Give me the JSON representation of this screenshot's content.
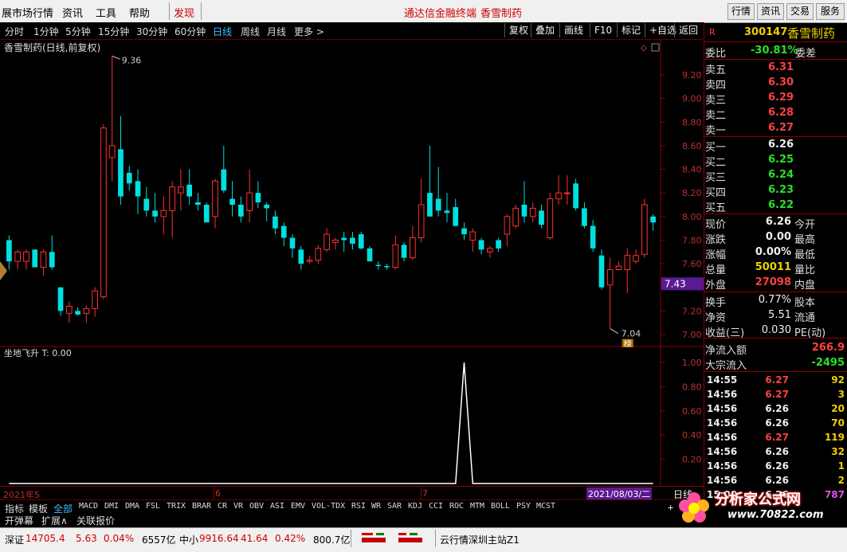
{
  "menu": {
    "items": [
      "展市场行情",
      "资讯",
      "工具",
      "帮助"
    ],
    "discover": "发现",
    "center_title": "通达信金融终端",
    "center_stock": "香雪制药",
    "right_buttons": [
      "行情",
      "资讯",
      "交易",
      "服务"
    ]
  },
  "toolbar": {
    "periods": [
      "分时",
      "1分钟",
      "5分钟",
      "15分钟",
      "30分钟",
      "60分钟",
      "日线",
      "周线",
      "月线",
      "更多 >"
    ],
    "active_period": "日线",
    "actions": [
      "复权",
      "叠加",
      "画线",
      "F10",
      "标记",
      "+自选",
      "返回"
    ]
  },
  "kline": {
    "title": "香雪制药(日线,前复权)",
    "high_label": "9.36",
    "low_label": "7.04",
    "badge": "榜",
    "current_price_tag": "7.43",
    "y_ticks": [
      "9.20",
      "9.00",
      "8.80",
      "8.60",
      "8.40",
      "8.20",
      "8.00",
      "7.80",
      "7.60",
      "7.40",
      "7.20",
      "7.00"
    ]
  },
  "indicator": {
    "title": "坐地飞升  T: 0.00",
    "y_ticks": [
      "1.00",
      "0.80",
      "0.60",
      "0.40",
      "0.20"
    ]
  },
  "date_axis": {
    "labels": [
      "2021年5",
      "6",
      "7"
    ],
    "current_date": "2021/08/03/二",
    "period_label": "日线"
  },
  "quote": {
    "code": "300147",
    "name": "香雪制药",
    "weibi_label": "委比",
    "weibi_value": "-30.81%",
    "weicha_label": "委差",
    "asks": [
      {
        "label": "卖五",
        "price": "6.31"
      },
      {
        "label": "卖四",
        "price": "6.30"
      },
      {
        "label": "卖三",
        "price": "6.29"
      },
      {
        "label": "卖二",
        "price": "6.28"
      },
      {
        "label": "卖一",
        "price": "6.27"
      }
    ],
    "bids": [
      {
        "label": "买一",
        "price": "6.26"
      },
      {
        "label": "买二",
        "price": "6.25"
      },
      {
        "label": "买三",
        "price": "6.24"
      },
      {
        "label": "买四",
        "price": "6.23"
      },
      {
        "label": "买五",
        "price": "6.22"
      }
    ],
    "stats": [
      {
        "label": "现价",
        "value": "6.26",
        "label2": "今开"
      },
      {
        "label": "涨跌",
        "value": "0.00",
        "label2": "最高"
      },
      {
        "label": "涨幅",
        "value": "0.00%",
        "label2": "最低"
      },
      {
        "label": "总量",
        "value": "50011",
        "label2": "量比"
      },
      {
        "label": "外盘",
        "value": "27098",
        "label2": "内盘"
      }
    ],
    "stats2": [
      {
        "label": "换手",
        "value": "0.77%",
        "label2": "股本"
      },
      {
        "label": "净资",
        "value": "5.51",
        "label2": "流通"
      },
      {
        "label": "收益(三)",
        "value": "0.030",
        "label2": "PE(动)"
      }
    ],
    "flow": [
      {
        "label": "净流入额",
        "value": "266.9"
      },
      {
        "label": "大宗流入",
        "value": "-2495"
      }
    ],
    "ticks": [
      {
        "time": "14:55",
        "price": "6.27",
        "vol": "92"
      },
      {
        "time": "14:56",
        "price": "6.27",
        "vol": "3"
      },
      {
        "time": "14:56",
        "price": "6.26",
        "vol": "20"
      },
      {
        "time": "14:56",
        "price": "6.26",
        "vol": "70"
      },
      {
        "time": "14:56",
        "price": "6.27",
        "vol": "119"
      },
      {
        "time": "14:56",
        "price": "6.26",
        "vol": "32"
      },
      {
        "time": "14:56",
        "price": "6.26",
        "vol": "1"
      },
      {
        "time": "14:56",
        "price": "6.26",
        "vol": "2"
      },
      {
        "time": "15:00",
        "price": "6.26",
        "vol": "787"
      }
    ]
  },
  "tabs": {
    "items": [
      "指标",
      "模板",
      "全部",
      "MACD",
      "DMI",
      "DMA",
      "FSL",
      "TRIX",
      "BRAR",
      "CR",
      "VR",
      "OBV",
      "ASI",
      "EMV",
      "VOL-TDX",
      "RSI",
      "WR",
      "SAR",
      "KDJ",
      "CCI",
      "ROC",
      "MTM",
      "BOLL",
      "PSY",
      "MCST"
    ],
    "row2": [
      "开弹幕",
      "扩展∧",
      "关联报价"
    ],
    "plus": "+"
  },
  "status": {
    "sz_label": "深证",
    "sz_value": "14705.4",
    "sz_change": "5.63",
    "sz_pct": "0.04%",
    "sz_amount": "6557亿",
    "zx_label": "中小",
    "zx_value": "9916.64",
    "zx_change": "41.64",
    "zx_pct": "0.42%",
    "zx_amount": "800.7亿",
    "server": "云行情深圳主站Z1"
  },
  "watermark": {
    "name": "分析家公式网",
    "url": "www.70822.com"
  },
  "colors": {
    "up": "#ff3030",
    "down": "#00e0e0",
    "grid": "#8a0000",
    "active": "#36c0ff"
  },
  "candles": [
    {
      "o": 7.8,
      "h": 7.84,
      "l": 7.55,
      "c": 7.62
    },
    {
      "o": 7.62,
      "h": 7.72,
      "l": 7.55,
      "c": 7.7
    },
    {
      "o": 7.62,
      "h": 7.72,
      "l": 7.55,
      "c": 7.7
    },
    {
      "o": 7.72,
      "h": 7.72,
      "l": 7.57,
      "c": 7.57
    },
    {
      "o": 7.57,
      "h": 7.72,
      "l": 7.5,
      "c": 7.7
    },
    {
      "o": 7.7,
      "h": 7.84,
      "l": 7.55,
      "c": 7.57
    },
    {
      "o": 7.4,
      "h": 7.4,
      "l": 7.16,
      "c": 7.2
    },
    {
      "o": 7.18,
      "h": 7.28,
      "l": 7.1,
      "c": 7.24
    },
    {
      "o": 7.2,
      "h": 7.23,
      "l": 7.16,
      "c": 7.17
    },
    {
      "o": 7.18,
      "h": 7.25,
      "l": 7.1,
      "c": 7.22
    },
    {
      "o": 7.22,
      "h": 7.4,
      "l": 7.15,
      "c": 7.37
    },
    {
      "o": 7.32,
      "h": 8.78,
      "l": 7.3,
      "c": 8.75
    },
    {
      "o": 8.5,
      "h": 9.36,
      "l": 8.3,
      "c": 8.6
    },
    {
      "o": 8.57,
      "h": 8.85,
      "l": 8.1,
      "c": 8.17
    },
    {
      "o": 8.37,
      "h": 8.43,
      "l": 8.22,
      "c": 8.28
    },
    {
      "o": 8.3,
      "h": 8.4,
      "l": 8.02,
      "c": 8.17
    },
    {
      "o": 8.15,
      "h": 8.25,
      "l": 8.0,
      "c": 8.05
    },
    {
      "o": 8.05,
      "h": 8.2,
      "l": 7.95,
      "c": 8.0
    },
    {
      "o": 8.0,
      "h": 8.17,
      "l": 7.85,
      "c": 8.05
    },
    {
      "o": 8.05,
      "h": 8.3,
      "l": 7.82,
      "c": 8.25
    },
    {
      "o": 8.2,
      "h": 8.4,
      "l": 8.05,
      "c": 8.25
    },
    {
      "o": 8.27,
      "h": 8.4,
      "l": 8.1,
      "c": 8.17
    },
    {
      "o": 8.12,
      "h": 8.2,
      "l": 8.05,
      "c": 8.1
    },
    {
      "o": 8.1,
      "h": 8.12,
      "l": 7.95,
      "c": 7.95
    },
    {
      "o": 8.0,
      "h": 8.32,
      "l": 7.9,
      "c": 8.3
    },
    {
      "o": 8.4,
      "h": 8.6,
      "l": 8.2,
      "c": 8.22
    },
    {
      "o": 8.15,
      "h": 8.3,
      "l": 8.0,
      "c": 8.1
    },
    {
      "o": 8.1,
      "h": 8.17,
      "l": 7.95,
      "c": 8.0
    },
    {
      "o": 8.05,
      "h": 8.4,
      "l": 7.95,
      "c": 8.2
    },
    {
      "o": 8.2,
      "h": 8.3,
      "l": 8.07,
      "c": 8.12
    },
    {
      "o": 8.1,
      "h": 8.12,
      "l": 7.96,
      "c": 8.07
    },
    {
      "o": 8.0,
      "h": 8.05,
      "l": 7.85,
      "c": 7.9
    },
    {
      "o": 7.92,
      "h": 7.95,
      "l": 7.75,
      "c": 7.82
    },
    {
      "o": 7.82,
      "h": 7.85,
      "l": 7.65,
      "c": 7.73
    },
    {
      "o": 7.72,
      "h": 7.75,
      "l": 7.55,
      "c": 7.6
    },
    {
      "o": 7.62,
      "h": 7.67,
      "l": 7.6,
      "c": 7.63
    },
    {
      "o": 7.63,
      "h": 7.76,
      "l": 7.6,
      "c": 7.73
    },
    {
      "o": 7.72,
      "h": 7.9,
      "l": 7.7,
      "c": 7.85
    },
    {
      "o": 7.78,
      "h": 7.82,
      "l": 7.72,
      "c": 7.8
    },
    {
      "o": 7.82,
      "h": 7.87,
      "l": 7.7,
      "c": 7.8
    },
    {
      "o": 7.82,
      "h": 7.87,
      "l": 7.72,
      "c": 7.77
    },
    {
      "o": 7.85,
      "h": 7.87,
      "l": 7.72,
      "c": 7.73
    },
    {
      "o": 7.73,
      "h": 7.75,
      "l": 7.62,
      "c": 7.62
    },
    {
      "o": 7.59,
      "h": 7.62,
      "l": 7.55,
      "c": 7.58
    },
    {
      "o": 7.58,
      "h": 7.6,
      "l": 7.55,
      "c": 7.57
    },
    {
      "o": 7.57,
      "h": 7.84,
      "l": 7.55,
      "c": 7.76
    },
    {
      "o": 7.76,
      "h": 7.78,
      "l": 7.62,
      "c": 7.65
    },
    {
      "o": 7.65,
      "h": 7.92,
      "l": 7.63,
      "c": 7.82
    },
    {
      "o": 7.82,
      "h": 8.32,
      "l": 7.78,
      "c": 8.1
    },
    {
      "o": 8.2,
      "h": 8.6,
      "l": 8.0,
      "c": 8.0
    },
    {
      "o": 8.15,
      "h": 8.42,
      "l": 8.0,
      "c": 8.05
    },
    {
      "o": 8.05,
      "h": 8.2,
      "l": 7.95,
      "c": 8.03
    },
    {
      "o": 8.08,
      "h": 8.15,
      "l": 7.92,
      "c": 7.92
    },
    {
      "o": 7.9,
      "h": 7.95,
      "l": 7.8,
      "c": 7.85
    },
    {
      "o": 7.8,
      "h": 7.9,
      "l": 7.7,
      "c": 7.87
    },
    {
      "o": 7.8,
      "h": 7.82,
      "l": 7.68,
      "c": 7.72
    },
    {
      "o": 7.7,
      "h": 7.75,
      "l": 7.65,
      "c": 7.73
    },
    {
      "o": 7.8,
      "h": 7.82,
      "l": 7.7,
      "c": 7.73
    },
    {
      "o": 7.85,
      "h": 8.02,
      "l": 7.75,
      "c": 8.0
    },
    {
      "o": 7.92,
      "h": 8.1,
      "l": 7.9,
      "c": 8.07
    },
    {
      "o": 8.1,
      "h": 8.3,
      "l": 7.95,
      "c": 8.0
    },
    {
      "o": 8.0,
      "h": 8.12,
      "l": 7.95,
      "c": 8.07
    },
    {
      "o": 8.05,
      "h": 8.1,
      "l": 7.9,
      "c": 7.93
    },
    {
      "o": 7.82,
      "h": 8.2,
      "l": 7.8,
      "c": 8.15
    },
    {
      "o": 8.15,
      "h": 8.35,
      "l": 8.1,
      "c": 8.2
    },
    {
      "o": 8.2,
      "h": 8.35,
      "l": 8.1,
      "c": 8.2
    },
    {
      "o": 8.28,
      "h": 8.32,
      "l": 8.05,
      "c": 8.07
    },
    {
      "o": 8.07,
      "h": 8.12,
      "l": 7.9,
      "c": 7.92
    },
    {
      "o": 7.92,
      "h": 7.97,
      "l": 7.7,
      "c": 7.73
    },
    {
      "o": 7.67,
      "h": 7.72,
      "l": 7.38,
      "c": 7.4
    },
    {
      "o": 7.42,
      "h": 7.65,
      "l": 7.05,
      "c": 7.55
    },
    {
      "o": 7.55,
      "h": 7.62,
      "l": 7.55,
      "c": 7.58
    },
    {
      "o": 7.55,
      "h": 7.73,
      "l": 7.35,
      "c": 7.67
    },
    {
      "o": 7.62,
      "h": 7.72,
      "l": 7.6,
      "c": 7.67
    },
    {
      "o": 7.68,
      "h": 8.15,
      "l": 7.65,
      "c": 8.1
    },
    {
      "o": 8.0,
      "h": 8.02,
      "l": 7.88,
      "c": 7.95
    }
  ],
  "indicator_series": {
    "spike_index": 53,
    "spike_value": 1.0
  }
}
